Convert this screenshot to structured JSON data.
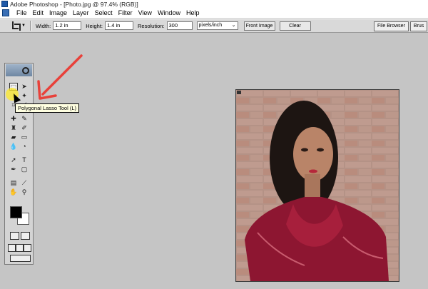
{
  "window": {
    "title": "Adobe Photoshop - [Photo.jpg @ 97.4% (RGB)]"
  },
  "menubar": {
    "items": [
      "File",
      "Edit",
      "Image",
      "Layer",
      "Select",
      "Filter",
      "View",
      "Window",
      "Help"
    ]
  },
  "options": {
    "width_label": "Width:",
    "width_value": "1.2 in",
    "height_label": "Height:",
    "height_value": "1.4 in",
    "resolution_label": "Resolution:",
    "resolution_value": "300",
    "units_value": "pixels/inch",
    "front_image_label": "Front Image",
    "clear_label": "Clear"
  },
  "palette_well": {
    "file_browser_label": "File Browser",
    "brushes_label": "Brus"
  },
  "tooltip": {
    "text": "Polygonal Lasso Tool (L)"
  },
  "colors": {
    "arrow": "#e8413a",
    "highlight": "#ffe628",
    "foreground": "#000000",
    "background": "#ffffff"
  },
  "photo": {
    "icon": "portrait-photo"
  }
}
